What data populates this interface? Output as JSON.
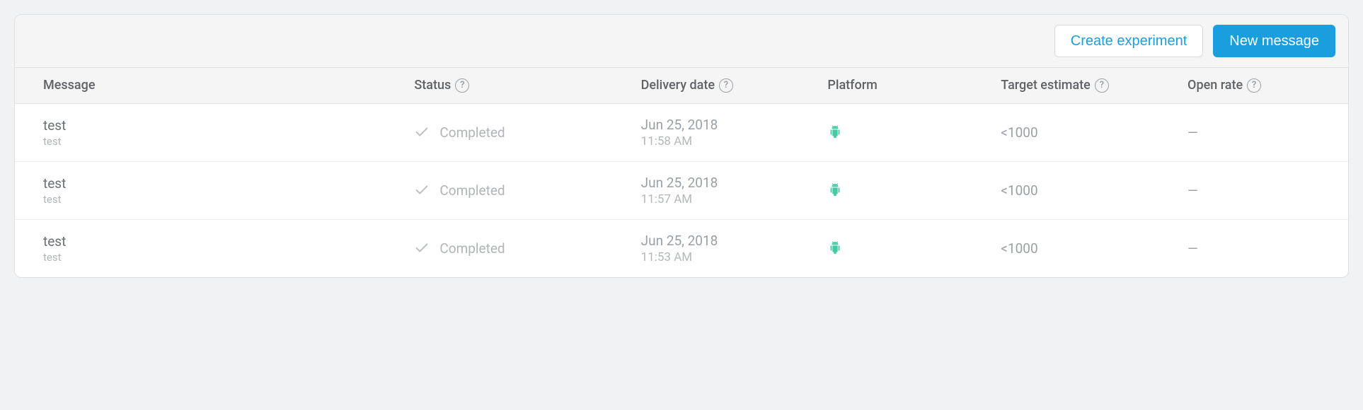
{
  "toolbar": {
    "create_experiment": "Create experiment",
    "new_message": "New message"
  },
  "columns": {
    "message": "Message",
    "status": "Status",
    "delivery": "Delivery date",
    "platform": "Platform",
    "target": "Target estimate",
    "open": "Open rate"
  },
  "rows": [
    {
      "title": "test",
      "subtitle": "test",
      "status": "Completed",
      "date": "Jun 25, 2018",
      "time": "11:58 AM",
      "platform": "android",
      "target": "<1000",
      "open": "—"
    },
    {
      "title": "test",
      "subtitle": "test",
      "status": "Completed",
      "date": "Jun 25, 2018",
      "time": "11:57 AM",
      "platform": "android",
      "target": "<1000",
      "open": "—"
    },
    {
      "title": "test",
      "subtitle": "test",
      "status": "Completed",
      "date": "Jun 25, 2018",
      "time": "11:53 AM",
      "platform": "android",
      "target": "<1000",
      "open": "—"
    }
  ]
}
